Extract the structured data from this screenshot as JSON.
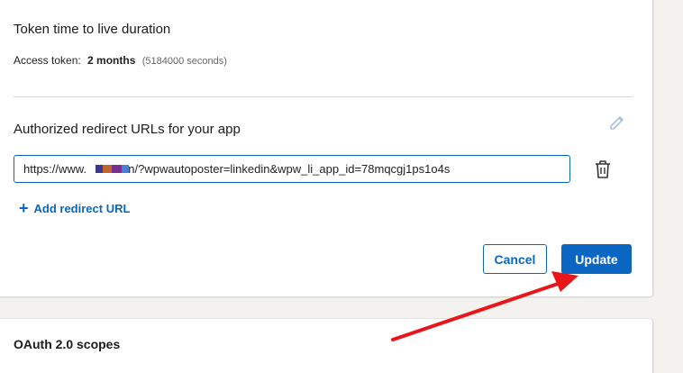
{
  "token_section": {
    "title": "Token time to live duration",
    "access_label": "Access token:",
    "access_value": "2 months",
    "access_seconds": "(5184000 seconds)"
  },
  "redirect_section": {
    "title": "Authorized redirect URLs for your app",
    "url_value": "https://www.          .vn/?wpwautoposter=linkedin&wpw_li_app_id=78mqcgj1ps1o4s",
    "add_label": "Add redirect URL"
  },
  "actions": {
    "cancel_label": "Cancel",
    "update_label": "Update"
  },
  "oauth_section": {
    "title": "OAuth 2.0 scopes"
  },
  "colors": {
    "accent": "#0a66c2",
    "annotation_arrow": "#e8161a",
    "redaction": [
      "#3a3a8c",
      "#c0662a",
      "#7a2f8f",
      "#4a7fd6"
    ]
  },
  "icons": {
    "edit": "pencil-icon",
    "delete": "trash-icon",
    "add": "plus-icon"
  }
}
